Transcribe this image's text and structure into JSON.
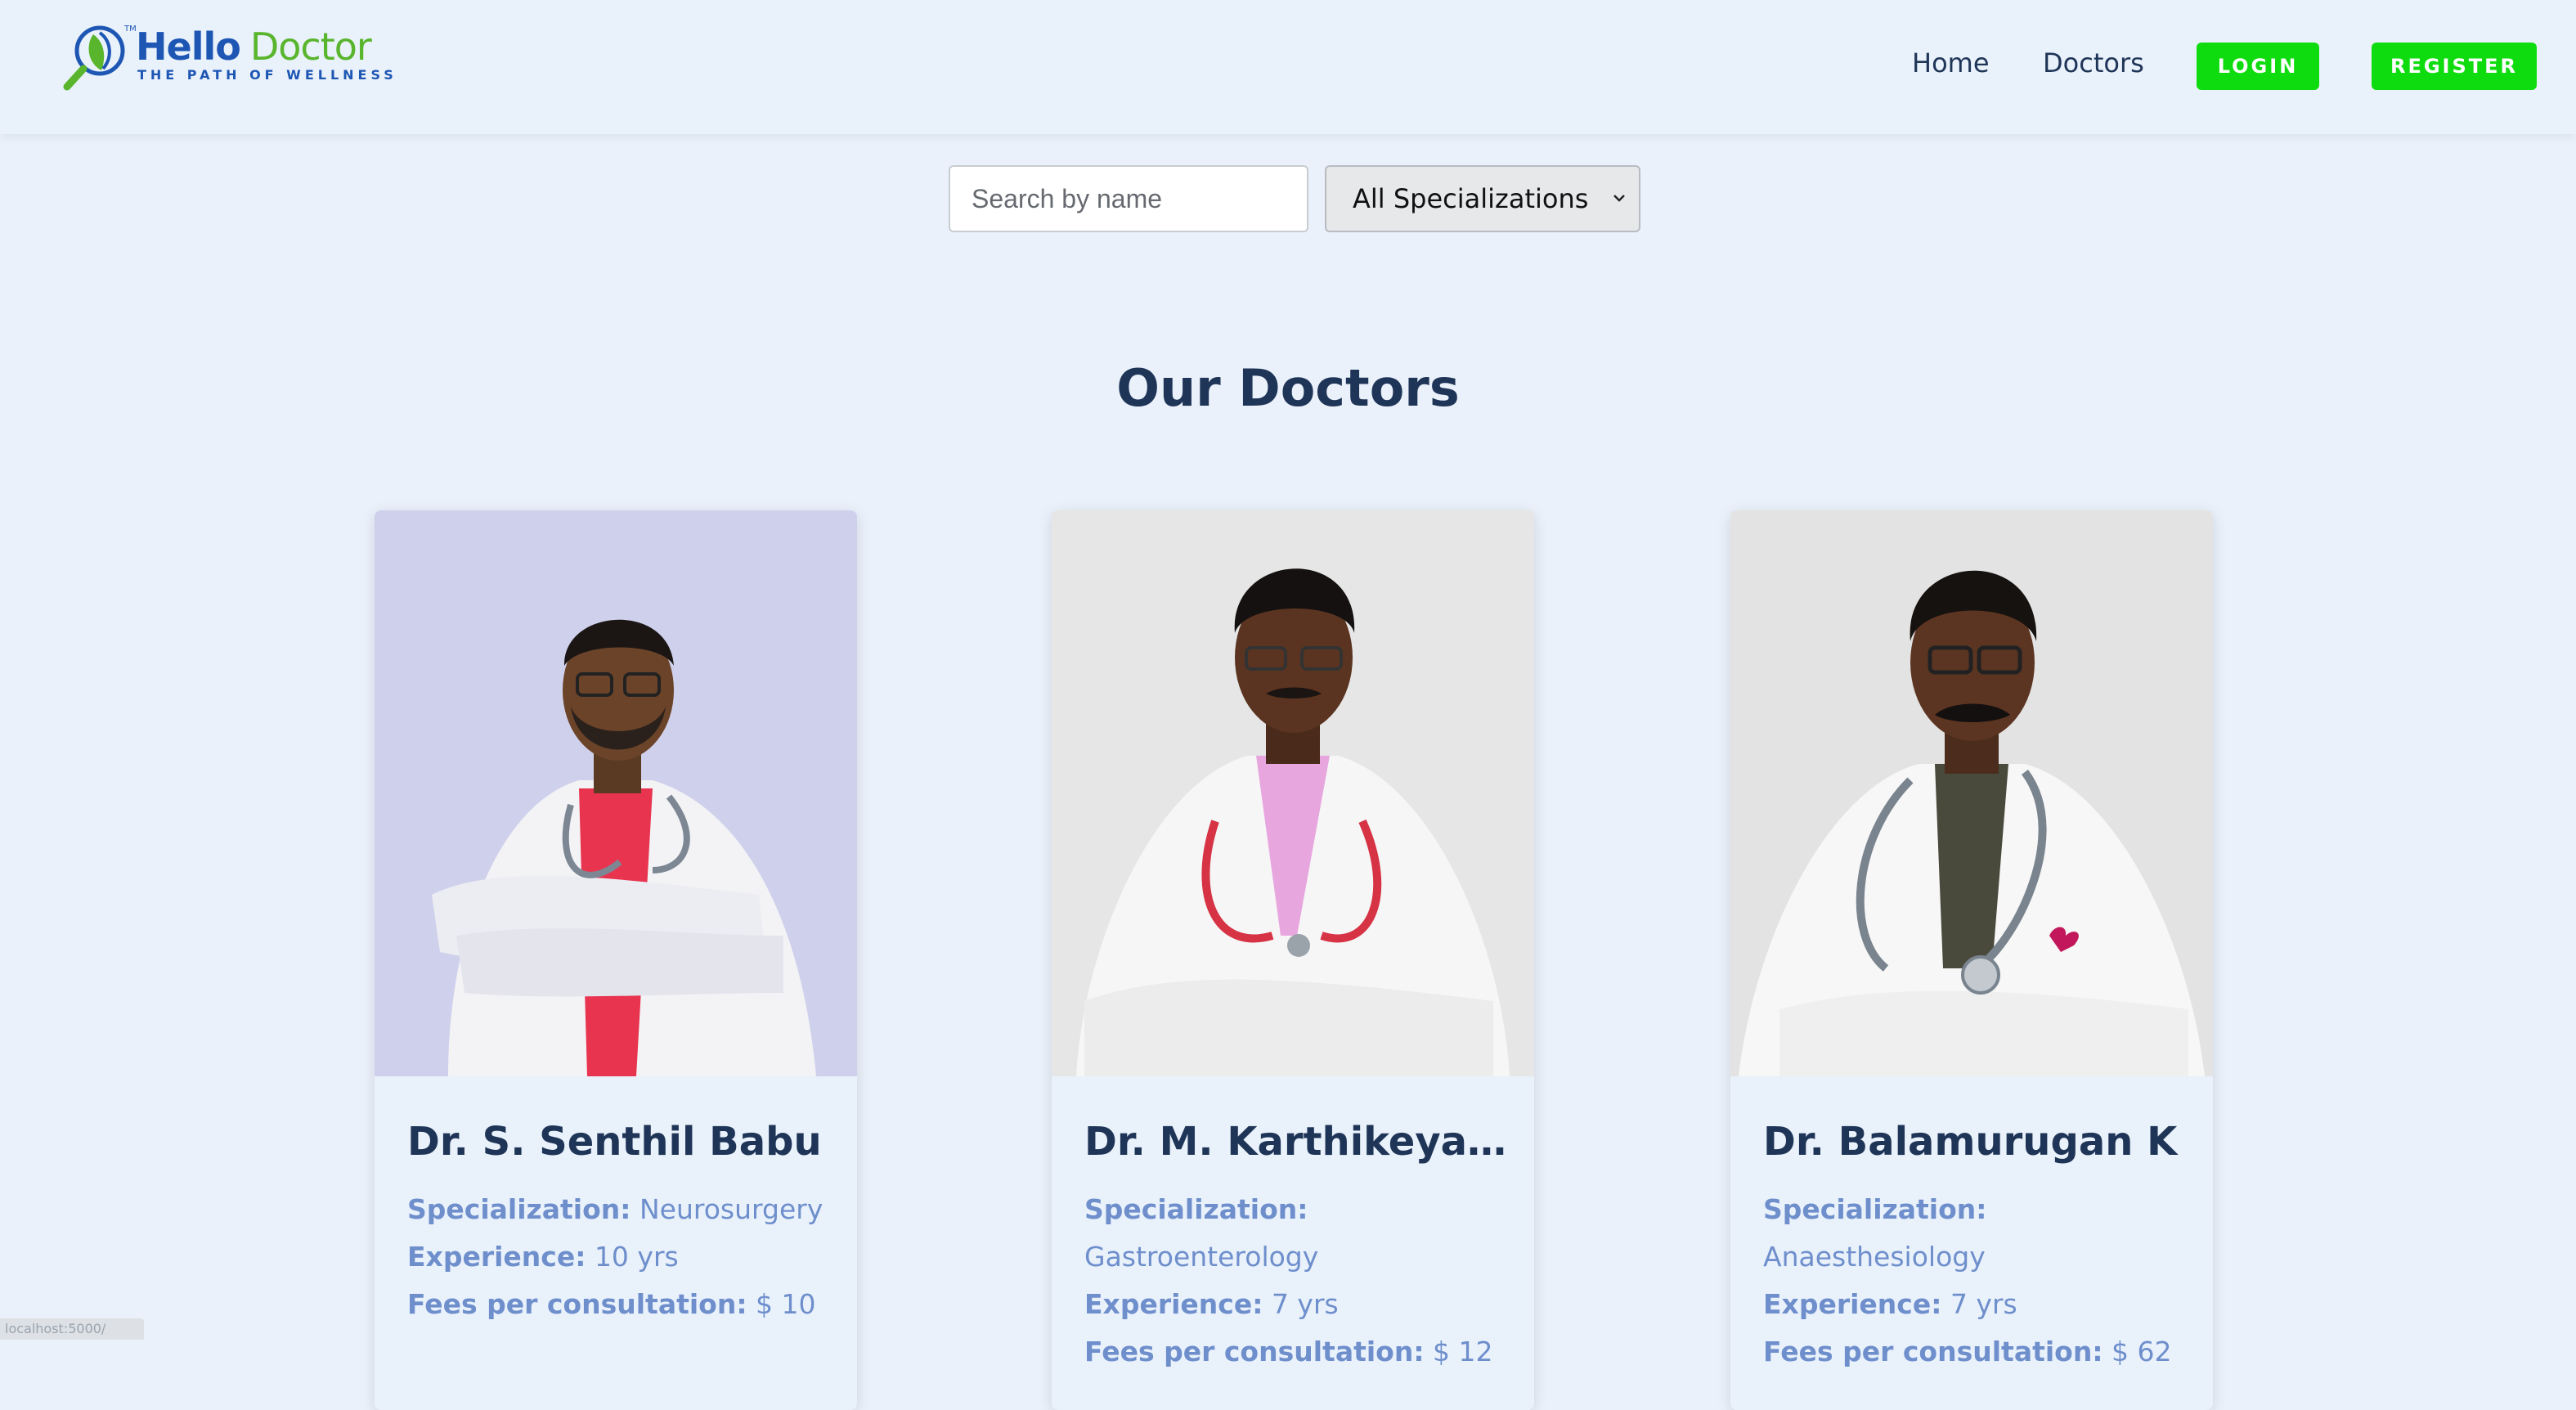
{
  "brand": {
    "name_part1": "Hello",
    "name_part2": "Doctor",
    "tagline": "THE PATH OF WELLNESS",
    "tm": "TM",
    "colors": {
      "blue": "#1d56b3",
      "green": "#58b52c"
    }
  },
  "nav": {
    "home": "Home",
    "doctors": "Doctors",
    "login": "LOGIN",
    "register": "REGISTER"
  },
  "search": {
    "placeholder": "Search by name",
    "value": ""
  },
  "filter": {
    "selected": "All Specializations"
  },
  "section": {
    "title": "Our Doctors"
  },
  "labels": {
    "specialization": "Specialization:",
    "experience": "Experience:",
    "fees": "Fees per consultation:"
  },
  "doctors": [
    {
      "name": "Dr. S. Senthil Babu",
      "specialization": "Neurosurgery",
      "experience": "10 yrs",
      "fees": "$ 10",
      "photo_bg": "#cdd0ea"
    },
    {
      "name": "Dr. M. Karthikeyan ...",
      "specialization": "Gastroenterology",
      "experience": "7 yrs",
      "fees": "$ 12",
      "photo_bg": "#e6e6e6"
    },
    {
      "name": "Dr. Balamurugan K",
      "specialization": "Anaesthesiology",
      "experience": "7 yrs",
      "fees": "$ 62",
      "photo_bg": "#e3e3e3"
    }
  ],
  "status_bar": {
    "text": "localhost:5000/"
  },
  "colors": {
    "page_bg": "#eaf1fb",
    "accent_button": "#0fdc0f",
    "heading": "#1f3557",
    "info_text": "#6e8fcc"
  }
}
